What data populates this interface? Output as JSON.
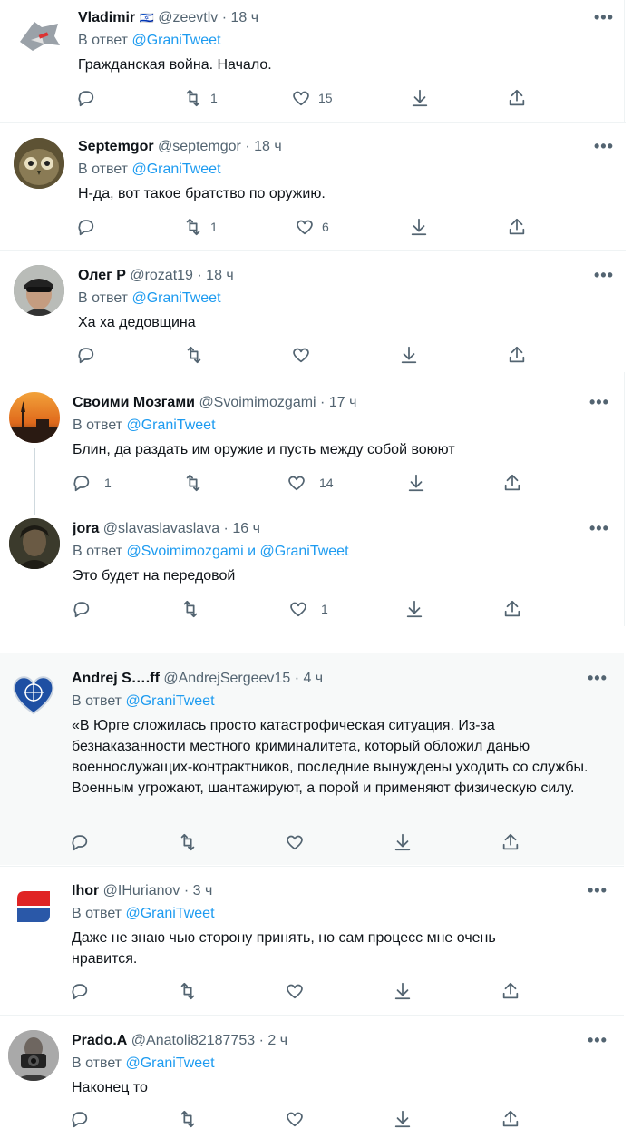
{
  "tweets": [
    {
      "name": "Vladimir",
      "flag": "🇮🇱",
      "handle": "@zeevtlv",
      "time": "· 18 ч",
      "reply_prefix": "В ответ",
      "reply_to": "@GraniTweet",
      "text": "Гражданская война. Начало.",
      "replies": "",
      "retweets": "1",
      "likes": "15"
    },
    {
      "name": "Septemgor",
      "handle": "@septemgor",
      "time": "· 18 ч",
      "reply_prefix": "В ответ",
      "reply_to": "@GraniTweet",
      "text": "Н-да, вот такое братство по оружию.",
      "replies": "",
      "retweets": "1",
      "likes": "6"
    },
    {
      "name": "Олег Р",
      "handle": "@rozat19",
      "time": "· 18 ч",
      "reply_prefix": "В ответ",
      "reply_to": "@GraniTweet",
      "text": "Ха ха дедовщина",
      "replies": "",
      "retweets": "",
      "likes": ""
    },
    {
      "name": "Своими Мозгами",
      "handle": "@Svoimimozgami",
      "time": "· 17 ч",
      "reply_prefix": "В ответ",
      "reply_to": "@GraniTweet",
      "text": "Блин, да раздать им оружие и пусть между собой воюют",
      "replies": "1",
      "retweets": "",
      "likes": "14"
    },
    {
      "name": "jora",
      "handle": "@slavaslavaslava",
      "time": "· 16 ч",
      "reply_prefix": "В ответ",
      "reply_to": "@Svoimimozgami и @GraniTweet",
      "text": "Это будет на передовой",
      "replies": "",
      "retweets": "",
      "likes": "1"
    },
    {
      "name": "Andrej S….ff",
      "handle": "@AndrejSergeev15",
      "time": "· 4 ч",
      "reply_prefix": "В ответ",
      "reply_to": "@GraniTweet",
      "text": "«В Юрге сложилась просто катастрофическая ситуация. Из-за безнаказанности местного криминалитета, который обложил данью военнослужащих-контрактников, последние вынуждены уходить со службы. Военным угрожают, шантажируют, а порой и применяют физическую силу.",
      "replies": "",
      "retweets": "",
      "likes": ""
    },
    {
      "name": "Ihor",
      "handle": "@IHurianov",
      "time": "· 3 ч",
      "reply_prefix": "В ответ",
      "reply_to": "@GraniTweet",
      "text": "Даже не знаю чью сторону принять, но сам процесс мне очень нравится.",
      "replies": "",
      "retweets": "",
      "likes": ""
    },
    {
      "name": "Prado.A",
      "handle": "@Anatoli82187753",
      "time": "· 2 ч",
      "reply_prefix": "В ответ",
      "reply_to": "@GraniTweet",
      "text": "Наконец то",
      "replies": "",
      "retweets": "",
      "likes": ""
    }
  ],
  "more_label": "•••"
}
